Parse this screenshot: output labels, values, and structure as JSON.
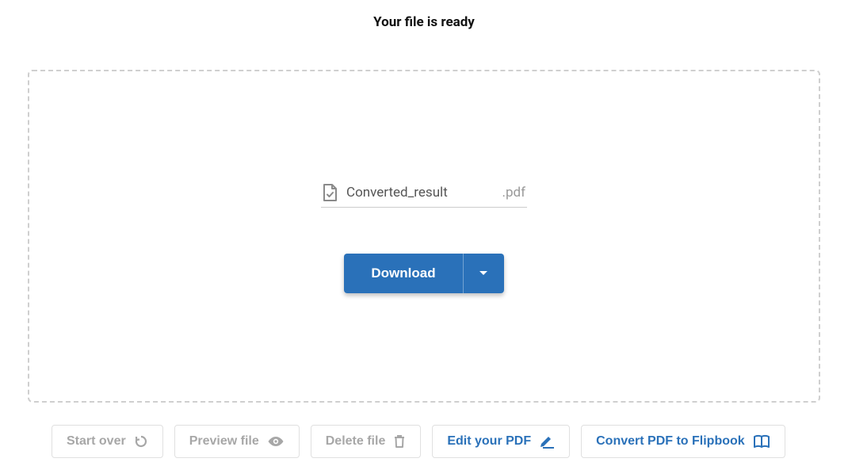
{
  "heading": "Your file is ready",
  "file": {
    "name": "Converted_result",
    "extension": ".pdf"
  },
  "download": {
    "label": "Download"
  },
  "actions": {
    "start_over": "Start over",
    "preview": "Preview file",
    "delete": "Delete file",
    "edit_pdf": "Edit your PDF",
    "flipbook": "Convert PDF to Flipbook"
  }
}
